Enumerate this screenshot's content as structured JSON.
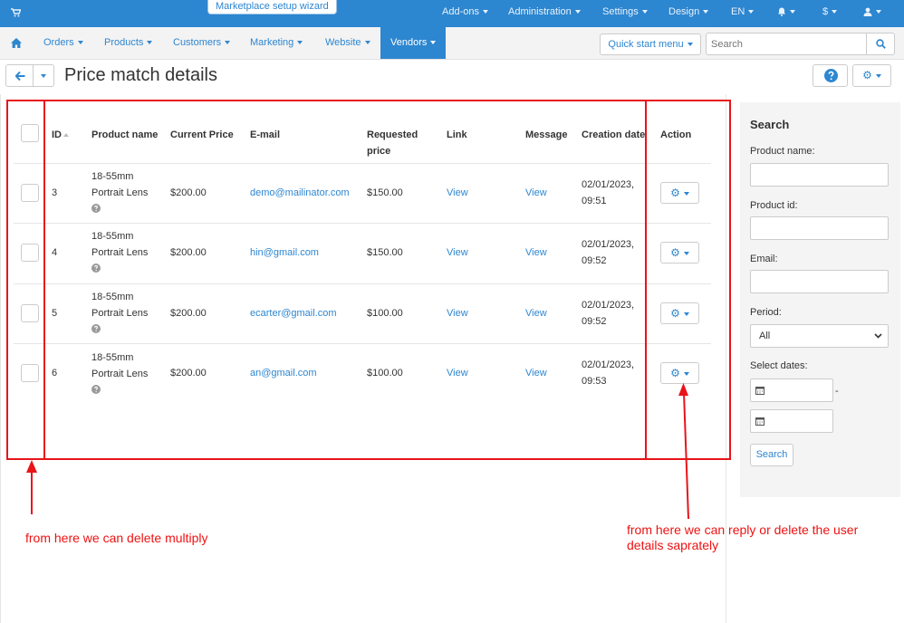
{
  "topbar": {
    "wizard": "Marketplace setup wizard",
    "items": [
      "Add-ons",
      "Administration",
      "Settings",
      "Design",
      "EN",
      "$"
    ]
  },
  "navbar": {
    "items": [
      "Orders",
      "Products",
      "Customers",
      "Marketing",
      "Website"
    ],
    "active": "Vendors",
    "quick_start": "Quick start menu",
    "search_placeholder": "Search"
  },
  "page": {
    "title": "Price match details"
  },
  "table": {
    "headers": {
      "id": "ID",
      "product_name": "Product name",
      "current_price": "Current Price",
      "email": "E-mail",
      "requested_price_1": "Requested",
      "requested_price_2": "price",
      "link": "Link",
      "message": "Message",
      "creation_date": "Creation date",
      "action": "Action"
    },
    "rows": [
      {
        "id": "3",
        "name_1": "18-55mm",
        "name_2": "Portrait Lens",
        "price": "$200.00",
        "email": "demo@mailinator.com",
        "requested": "$150.00",
        "link": "View",
        "message": "View",
        "date": "02/01/2023,",
        "time": "09:51"
      },
      {
        "id": "4",
        "name_1": "18-55mm",
        "name_2": "Portrait Lens",
        "price": "$200.00",
        "email": "hin@gmail.com",
        "requested": "$150.00",
        "link": "View",
        "message": "View",
        "date": "02/01/2023,",
        "time": "09:52"
      },
      {
        "id": "5",
        "name_1": "18-55mm",
        "name_2": "Portrait Lens",
        "price": "$200.00",
        "email": "ecarter@gmail.com",
        "requested": "$100.00",
        "link": "View",
        "message": "View",
        "date": "02/01/2023,",
        "time": "09:52"
      },
      {
        "id": "6",
        "name_1": "18-55mm",
        "name_2": "Portrait Lens",
        "price": "$200.00",
        "email": "an@gmail.com",
        "requested": "$100.00",
        "link": "View",
        "message": "View",
        "date": "02/01/2023,",
        "time": "09:53"
      }
    ]
  },
  "sidebar": {
    "title": "Search",
    "product_name_label": "Product name:",
    "product_id_label": "Product id:",
    "email_label": "Email:",
    "period_label": "Period:",
    "period_value": "All",
    "select_dates_label": "Select dates:",
    "date_separator": "-",
    "search_button": "Search"
  },
  "annotations": {
    "left": "from here we can delete multiply",
    "right_1": "from here we can reply or delete the user",
    "right_2": "details saprately"
  },
  "colors": {
    "brand": "#2d86d0",
    "annotation": "#e8141a"
  },
  "icons": [
    "cart-icon",
    "home-icon",
    "search-icon",
    "arrow-left-icon",
    "question-circle-icon",
    "gear-icon",
    "bell-icon",
    "user-icon",
    "calendar-icon",
    "sort-up-icon"
  ]
}
